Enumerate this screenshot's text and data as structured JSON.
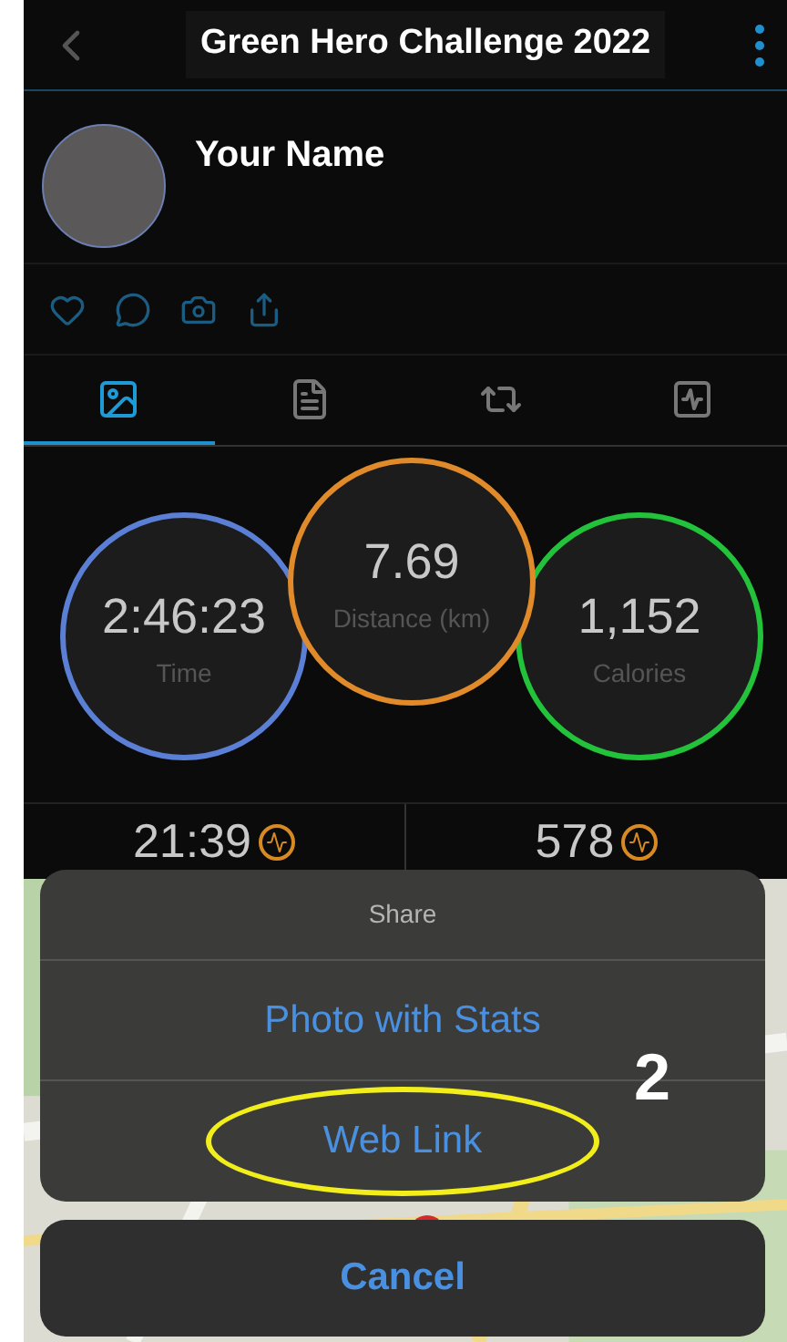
{
  "header": {
    "title": "Green Hero Challenge 2022"
  },
  "profile": {
    "name": "Your Name"
  },
  "tabs": [
    {
      "kind": "overview",
      "selected": true
    },
    {
      "kind": "details",
      "selected": false
    },
    {
      "kind": "laps",
      "selected": false
    },
    {
      "kind": "chart",
      "selected": false
    }
  ],
  "stats": [
    {
      "value": "2:46:23",
      "label": "Time",
      "color": "#5b7fd4"
    },
    {
      "value": "7.69",
      "label": "Distance (km)",
      "color": "#e08a2a"
    },
    {
      "value": "1,152",
      "label": "Calories",
      "color": "#22c33a"
    }
  ],
  "summary": [
    {
      "value": "21:39"
    },
    {
      "value": "578"
    }
  ],
  "share_sheet": {
    "title": "Share",
    "options": [
      {
        "label": "Photo with Stats",
        "highlighted": false
      },
      {
        "label": "Web Link",
        "highlighted": true
      }
    ],
    "cancel": "Cancel"
  },
  "annotation": {
    "label": "2"
  }
}
